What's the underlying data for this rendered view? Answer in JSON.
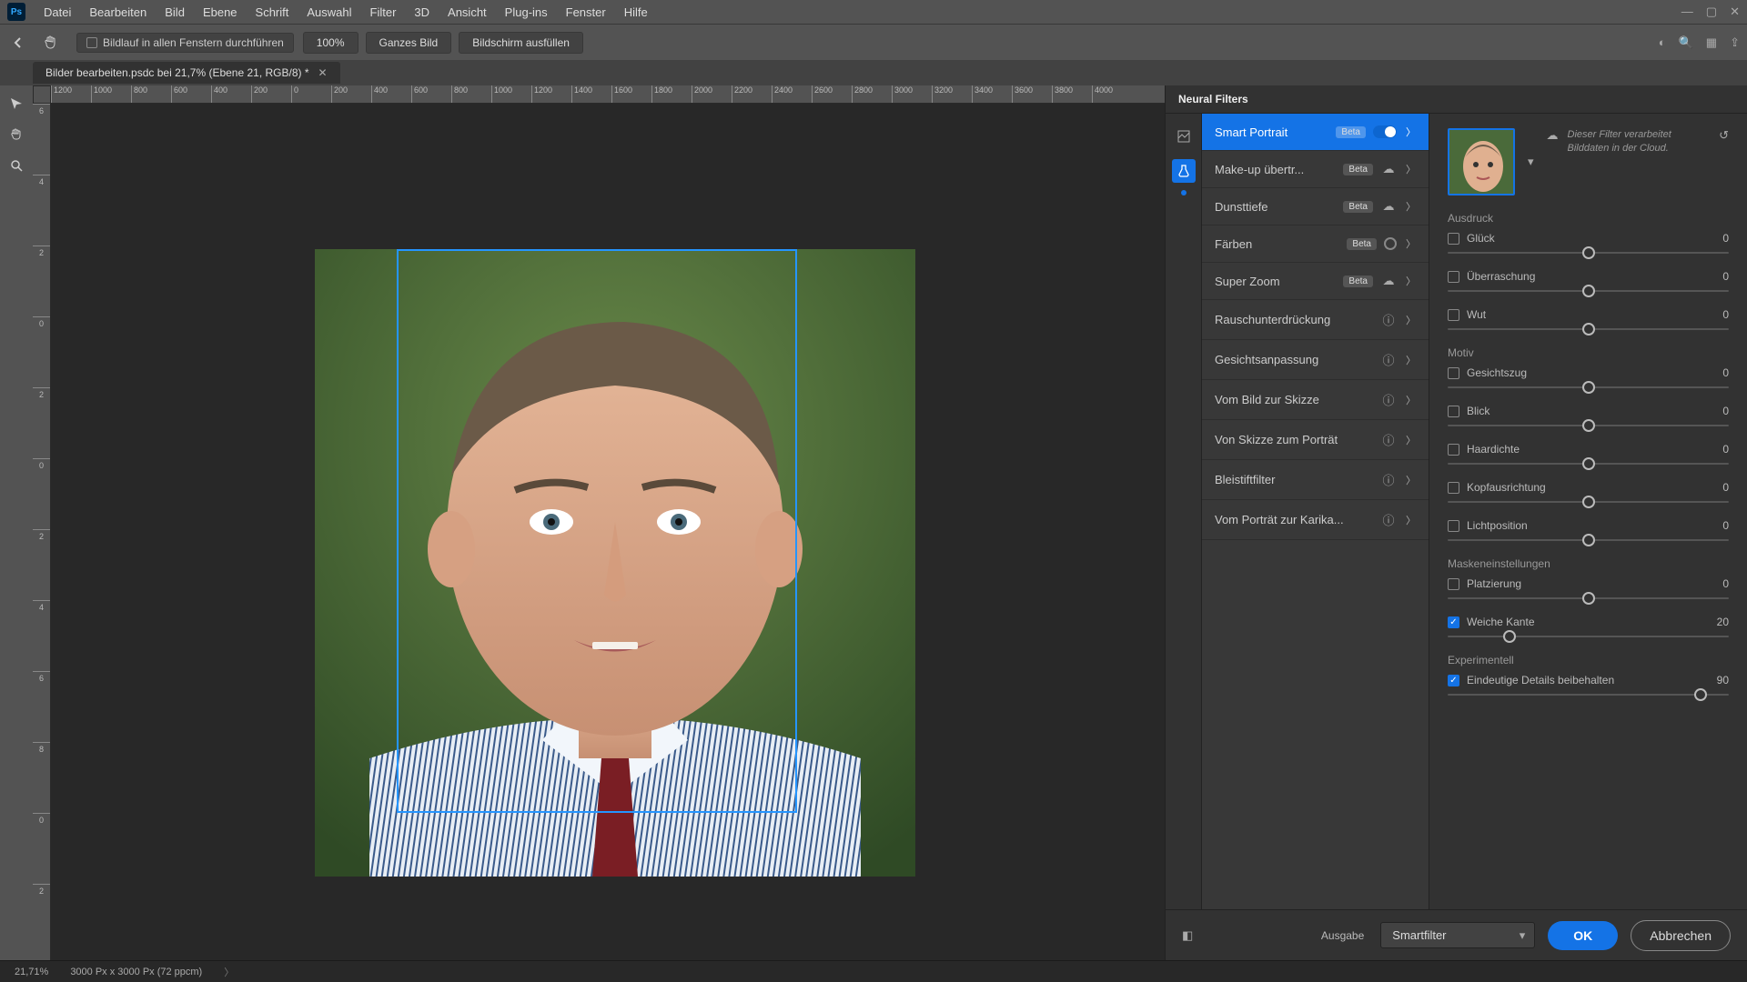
{
  "menubar": {
    "items": [
      "Datei",
      "Bearbeiten",
      "Bild",
      "Ebene",
      "Schrift",
      "Auswahl",
      "Filter",
      "3D",
      "Ansicht",
      "Plug-ins",
      "Fenster",
      "Hilfe"
    ]
  },
  "optbar": {
    "scroll_all": "Bildlauf in allen Fenstern durchführen",
    "btn_100": "100%",
    "btn_whole": "Ganzes Bild",
    "btn_fill": "Bildschirm ausfüllen"
  },
  "tab": {
    "title": "Bilder bearbeiten.psdc bei 21,7% (Ebene 21, RGB/8) *"
  },
  "ruler_h": [
    "1200",
    "1000",
    "800",
    "600",
    "400",
    "200",
    "0",
    "200",
    "400",
    "600",
    "800",
    "1000",
    "1200",
    "1400",
    "1600",
    "1800",
    "2000",
    "2200",
    "2400",
    "2600",
    "2800",
    "3000",
    "3200",
    "3400",
    "3600",
    "3800",
    "4000"
  ],
  "ruler_v": [
    "6",
    "4",
    "2",
    "0",
    "2",
    "0",
    "2",
    "4",
    "6",
    "8",
    "0",
    "2"
  ],
  "panel": {
    "title": "Neural Filters",
    "filters": [
      {
        "label": "Smart Portrait",
        "beta": true,
        "state": "on",
        "selected": true
      },
      {
        "label": "Make-up übertr...",
        "beta": true,
        "state": "cloud"
      },
      {
        "label": "Dunsttiefe",
        "beta": true,
        "state": "cloud"
      },
      {
        "label": "Färben",
        "beta": true,
        "state": "radio"
      },
      {
        "label": "Super Zoom",
        "beta": true,
        "state": "cloud"
      },
      {
        "label": "Rauschunterdrückung",
        "beta": false,
        "state": "info"
      },
      {
        "label": "Gesichtsanpassung",
        "beta": false,
        "state": "info"
      },
      {
        "label": "Vom Bild zur Skizze",
        "beta": false,
        "state": "info"
      },
      {
        "label": "Von Skizze zum Porträt",
        "beta": false,
        "state": "info"
      },
      {
        "label": "Bleistiftfilter",
        "beta": false,
        "state": "info"
      },
      {
        "label": "Vom Porträt zur Karika...",
        "beta": false,
        "state": "info"
      }
    ],
    "cloud_msg": "Dieser Filter verarbeitet Bilddaten in der Cloud.",
    "sections": {
      "ausdruck": "Ausdruck",
      "motiv": "Motiv",
      "masken": "Maskeneinstellungen",
      "experimentell": "Experimentell"
    },
    "sliders": [
      {
        "key": "gluck",
        "label": "Glück",
        "value": 0,
        "checked": false,
        "pos": 50
      },
      {
        "key": "uberraschung",
        "label": "Überraschung",
        "value": 0,
        "checked": false,
        "pos": 50
      },
      {
        "key": "wut",
        "label": "Wut",
        "value": 0,
        "checked": false,
        "pos": 50
      },
      {
        "key": "gesichtszug",
        "label": "Gesichtszug",
        "value": 0,
        "checked": false,
        "pos": 50
      },
      {
        "key": "blick",
        "label": "Blick",
        "value": 0,
        "checked": false,
        "pos": 50
      },
      {
        "key": "haardichte",
        "label": "Haardichte",
        "value": 0,
        "checked": false,
        "pos": 50
      },
      {
        "key": "kopfausrichtung",
        "label": "Kopfausrichtung",
        "value": 0,
        "checked": false,
        "pos": 50
      },
      {
        "key": "lichtposition",
        "label": "Lichtposition",
        "value": 0,
        "checked": false,
        "pos": 50
      },
      {
        "key": "platzierung",
        "label": "Platzierung",
        "value": 0,
        "checked": false,
        "pos": 50
      },
      {
        "key": "weiche_kante",
        "label": "Weiche Kante",
        "value": 20,
        "checked": true,
        "pos": 22
      },
      {
        "key": "details",
        "label": "Eindeutige Details beibehalten",
        "value": 90,
        "checked": true,
        "pos": 90
      }
    ],
    "footer": {
      "output_label": "Ausgabe",
      "output_value": "Smartfilter",
      "ok": "OK",
      "cancel": "Abbrechen"
    }
  },
  "status": {
    "zoom": "21,71%",
    "dims": "3000 Px x 3000 Px (72 ppcm)"
  }
}
